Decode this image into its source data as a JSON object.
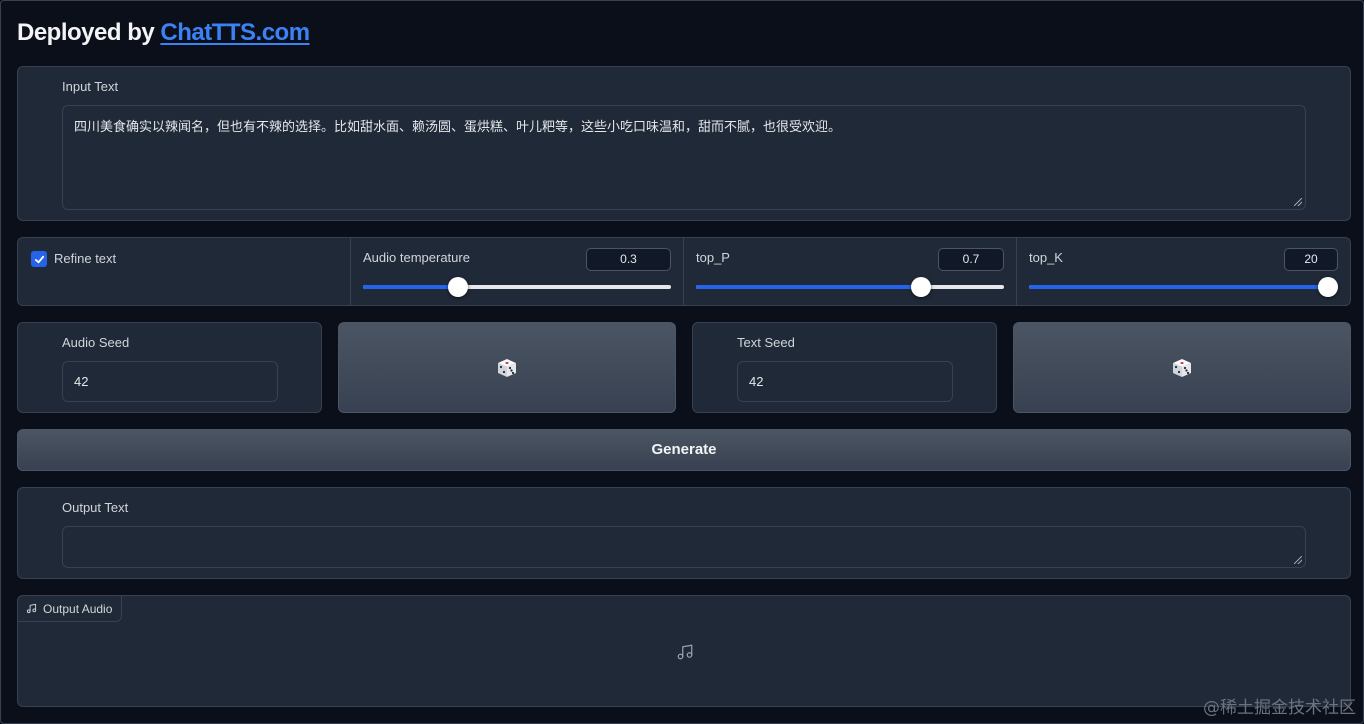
{
  "header": {
    "prefix": "Deployed by ",
    "link_text": "ChatTTS.com"
  },
  "input_text": {
    "label": "Input Text",
    "value": "四川美食确实以辣闻名，但也有不辣的选择。比如甜水面、赖汤圆、蛋烘糕、叶儿粑等，这些小吃口味温和，甜而不腻，也很受欢迎。"
  },
  "controls": {
    "refine_label": "Refine text",
    "refine_checked": true,
    "audio_temperature": {
      "label": "Audio temperature",
      "value": "0.3",
      "fraction": 0.31
    },
    "top_p": {
      "label": "top_P",
      "value": "0.7",
      "fraction": 0.73
    },
    "top_k": {
      "label": "top_K",
      "value": "20",
      "fraction": 1.0
    }
  },
  "seeds": {
    "audio_label": "Audio Seed",
    "audio_value": "42",
    "text_label": "Text Seed",
    "text_value": "42",
    "dice_icon": "dice-icon"
  },
  "generate_label": "Generate",
  "output_text": {
    "label": "Output Text",
    "value": ""
  },
  "output_audio": {
    "label": "Output Audio",
    "icon": "music-note-icon"
  },
  "watermark": "@稀土掘金技术社区",
  "colors": {
    "background": "#0b0f19",
    "panel": "#1f2937",
    "accent": "#2563eb",
    "link": "#3b82f6"
  }
}
